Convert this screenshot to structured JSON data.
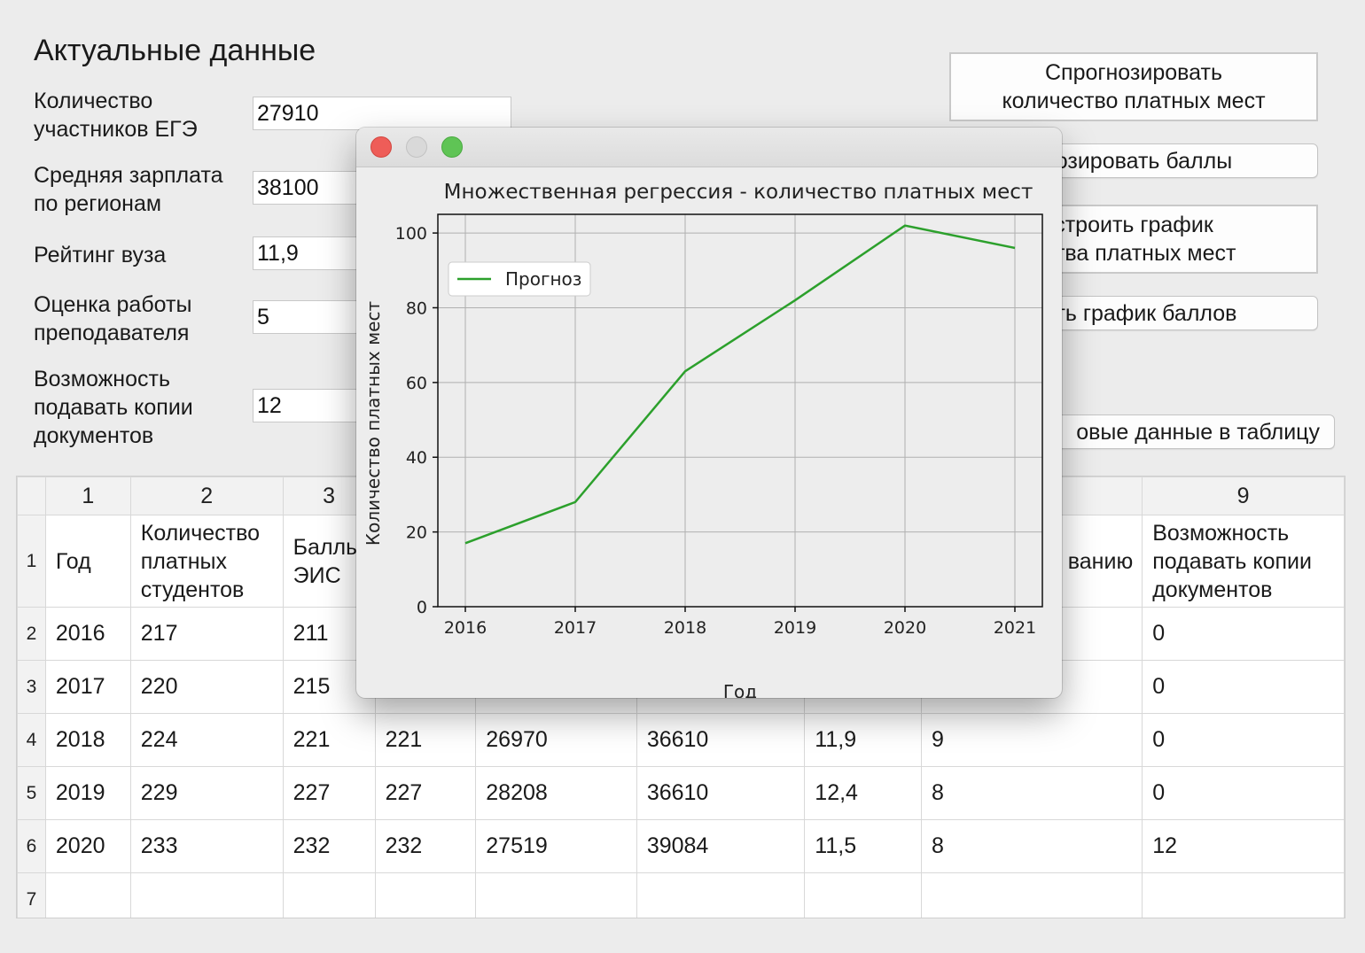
{
  "form": {
    "heading": "Актуальные данные",
    "fields": [
      {
        "label_line1": "Количество",
        "label_line2": "участников ЕГЭ",
        "value": "27910"
      },
      {
        "label_line1": "Средняя зарплата",
        "label_line2": "по регионам",
        "value": "38100"
      },
      {
        "label_line1": "Рейтинг вуза",
        "label_line2": "",
        "value": "11,9"
      },
      {
        "label_line1": "Оценка работы",
        "label_line2": "преподавателя",
        "value": "5"
      },
      {
        "label_line1": "Возможность",
        "label_line2": "подавать копии",
        "label_line3": "документов",
        "value": "12"
      }
    ]
  },
  "buttons": {
    "predict_places_line1": "Спрогнозировать",
    "predict_places_line2": "количество платных мест",
    "predict_scores": "гнозировать баллы",
    "plot_places_line1": "строить график",
    "plot_places_line2": "ества платных мест",
    "plot_scores": "оить график баллов",
    "add_data": "овые данные в таблицу"
  },
  "table": {
    "col_numbers": [
      "1",
      "2",
      "3",
      "",
      "",
      "",
      "",
      "",
      "9"
    ],
    "header_row_number": "1",
    "header_cells": [
      "Год",
      "Количество платных студентов",
      "Баллы ЭИС",
      "",
      "",
      "",
      "",
      "теля по ванию",
      "Возможность подавать копии документов"
    ],
    "rows": [
      {
        "n": "2",
        "cells": [
          "2016",
          "217",
          "211",
          "",
          "",
          "",
          "",
          "",
          "0"
        ]
      },
      {
        "n": "3",
        "cells": [
          "2017",
          "220",
          "215",
          "",
          "",
          "",
          "",
          "",
          "0"
        ]
      },
      {
        "n": "4",
        "cells": [
          "2018",
          "224",
          "221",
          "221",
          "26970",
          "36610",
          "11,9",
          "9",
          "0"
        ]
      },
      {
        "n": "5",
        "cells": [
          "2019",
          "229",
          "227",
          "227",
          "28208",
          "36610",
          "12,4",
          "8",
          "0"
        ]
      },
      {
        "n": "6",
        "cells": [
          "2020",
          "233",
          "232",
          "232",
          "27519",
          "39084",
          "11,5",
          "8",
          "12"
        ]
      },
      {
        "n": "7",
        "cells": [
          "",
          "",
          "",
          "",
          "",
          "",
          "",
          "",
          ""
        ]
      }
    ]
  },
  "chart_data": {
    "type": "line",
    "title": "Множественная регрессия - количество платных мест",
    "xlabel": "Год",
    "ylabel": "Количество платных мест",
    "x": [
      2016,
      2017,
      2018,
      2019,
      2020,
      2021
    ],
    "series": [
      {
        "name": "Прогноз",
        "values": [
          17,
          28,
          63,
          82,
          102,
          96
        ],
        "color": "#2ca02c"
      }
    ],
    "xlim": [
      2016,
      2021
    ],
    "ylim": [
      0,
      105
    ],
    "yticks": [
      0,
      20,
      40,
      60,
      80,
      100
    ],
    "grid": true,
    "legend": "top-left"
  }
}
